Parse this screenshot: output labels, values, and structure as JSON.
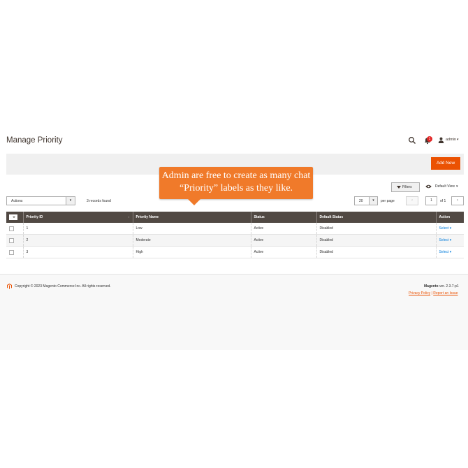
{
  "page": {
    "title": "Manage Priority"
  },
  "header": {
    "notifications_count": "1",
    "user_name": "admin",
    "icons": {
      "search": "search-icon",
      "notifications": "bell-icon",
      "user": "user-icon"
    }
  },
  "toolbar": {
    "add_new_label": "Add New"
  },
  "callout": {
    "line1": "Admin are free to create as many chat",
    "line2": "“Priority” labels as they like."
  },
  "grid_controls": {
    "filters_label": "Filters",
    "view_label": "Default View",
    "actions_label": "Actions",
    "records_found": "3 records found",
    "per_page_value": "20",
    "per_page_label": "per page",
    "current_page": "1",
    "of_pages": "of 1"
  },
  "table": {
    "columns": [
      "Priority ID",
      "Priority Name",
      "Status",
      "Default Status",
      "Action"
    ],
    "rows": [
      {
        "id": "1",
        "name": "Low",
        "status": "Active",
        "default_status": "Disabled",
        "action": "Select"
      },
      {
        "id": "2",
        "name": "Moderate",
        "status": "Active",
        "default_status": "Disabled",
        "action": "Select"
      },
      {
        "id": "3",
        "name": "High",
        "status": "Active",
        "default_status": "Disabled",
        "action": "Select"
      }
    ]
  },
  "footer": {
    "copyright": "Copyright © 2023 Magento Commerce Inc. All rights reserved.",
    "brand": "Magento",
    "version": " ver. 2.3.7-p1",
    "privacy_label": "Privacy Policy",
    "separator": "|",
    "report_label": "Report an Issue"
  },
  "colors": {
    "accent": "#eb5202",
    "header_bg": "#514943",
    "callout": "#f07a2a",
    "link": "#007bdb"
  }
}
